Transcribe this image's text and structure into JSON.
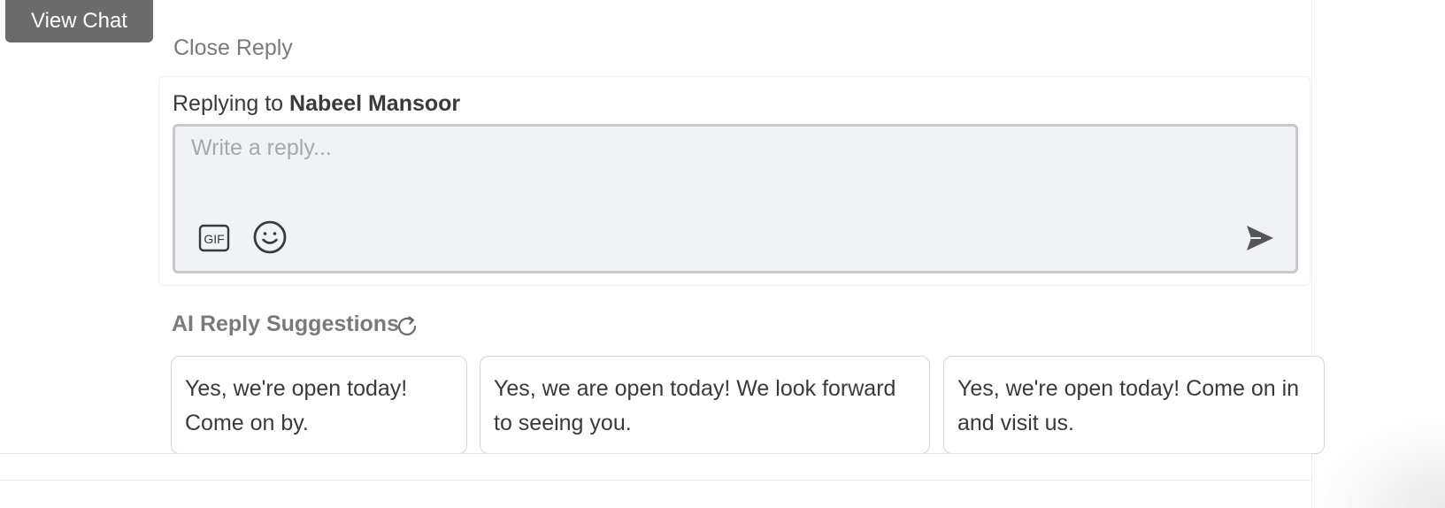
{
  "header": {
    "view_chat_label": "View Chat"
  },
  "reply": {
    "close_label": "Close Reply",
    "replying_to_prefix": "Replying to",
    "recipient_name": "Nabeel Mansoor",
    "input_placeholder": "Write a reply...",
    "input_value": "",
    "gif_label": "GIF"
  },
  "ai": {
    "title": "AI Reply Suggestions",
    "suggestions": [
      "Yes, we're open today! Come on by.",
      "Yes, we are open today! We look forward to seeing you.",
      "Yes, we're open today! Come on in and visit us."
    ]
  },
  "icons": {
    "gif": "gif-icon",
    "emoji": "smiley-icon",
    "send": "send-icon",
    "refresh": "refresh-icon"
  },
  "colors": {
    "view_chat_bg": "#6b6b6b",
    "composer_bg": "#f1f2f5",
    "muted_text": "#7a7a7a",
    "body_text": "#3a3a3a"
  }
}
